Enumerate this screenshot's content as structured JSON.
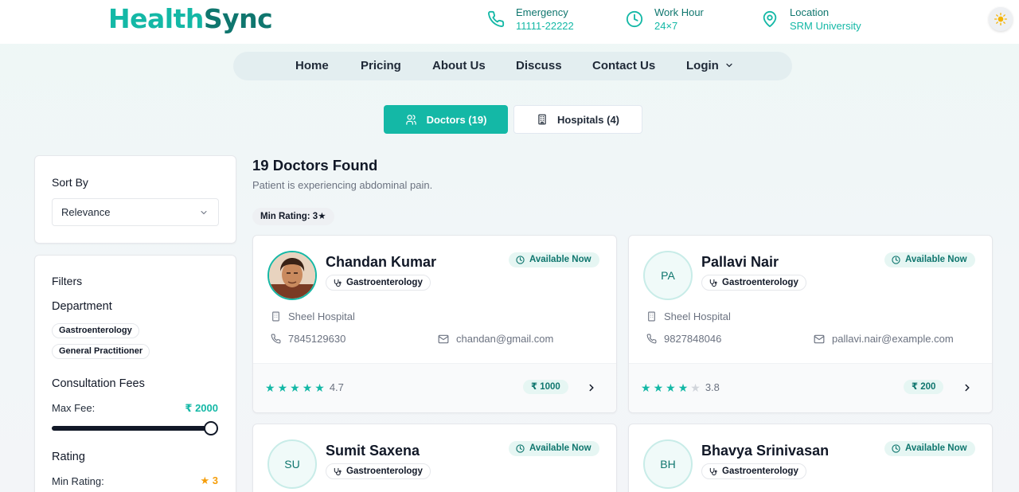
{
  "brand": {
    "part1": "Health",
    "part2": "Sync"
  },
  "header_info": [
    {
      "label": "Emergency",
      "value": "11111-22222",
      "icon": "phone-icon"
    },
    {
      "label": "Work Hour",
      "value": "24×7",
      "icon": "clock-icon"
    },
    {
      "label": "Location",
      "value": "SRM University",
      "icon": "map-pin-icon"
    }
  ],
  "theme_icon": "sun-icon",
  "nav": {
    "items": [
      "Home",
      "Pricing",
      "About Us",
      "Discuss",
      "Contact Us",
      "Login"
    ],
    "login_icon": "chevron-down-icon"
  },
  "tabs": {
    "doctors": "Doctors (19)",
    "hospitals": "Hospitals (4)",
    "active": "doctors"
  },
  "sort": {
    "title": "Sort By",
    "selected": "Relevance"
  },
  "filters": {
    "title": "Filters",
    "department_title": "Department",
    "departments": [
      "Gastroenterology",
      "General Practitioner"
    ],
    "fees_title": "Consultation Fees",
    "max_fee_label": "Max Fee:",
    "max_fee_value": "₹ 2000",
    "max_fee_fraction": 1.0,
    "rating_title": "Rating",
    "min_rating_label": "Min Rating:",
    "min_rating_value": "3"
  },
  "results": {
    "title": "19 Doctors Found",
    "subtitle": "Patient is experiencing abdominal pain.",
    "min_rating_chip": "Min Rating: 3★"
  },
  "doctors": [
    {
      "name": "Chandan Kumar",
      "initials": "",
      "photo": true,
      "department": "Gastroenterology",
      "availability": "Available Now",
      "hospital": "Sheel Hospital",
      "phone": "7845129630",
      "email": "chandan@gmail.com",
      "rating": "4.7",
      "filled_stars": 5,
      "fee": "₹ 1000"
    },
    {
      "name": "Pallavi Nair",
      "initials": "PA",
      "photo": false,
      "department": "Gastroenterology",
      "availability": "Available Now",
      "hospital": "Sheel Hospital",
      "phone": "9827848046",
      "email": "pallavi.nair@example.com",
      "rating": "3.8",
      "filled_stars": 4,
      "fee": "₹ 200"
    },
    {
      "name": "Sumit Saxena",
      "initials": "SU",
      "photo": false,
      "department": "Gastroenterology",
      "availability": "Available Now"
    },
    {
      "name": "Bhavya Srinivasan",
      "initials": "BH",
      "photo": false,
      "department": "Gastroenterology",
      "availability": "Available Now"
    }
  ],
  "colors": {
    "accent": "#14b8a6",
    "accent_dark": "#0f766e",
    "star": "#14b8a6",
    "star_empty": "#d1d5db",
    "star_filter": "#f59e0b"
  }
}
